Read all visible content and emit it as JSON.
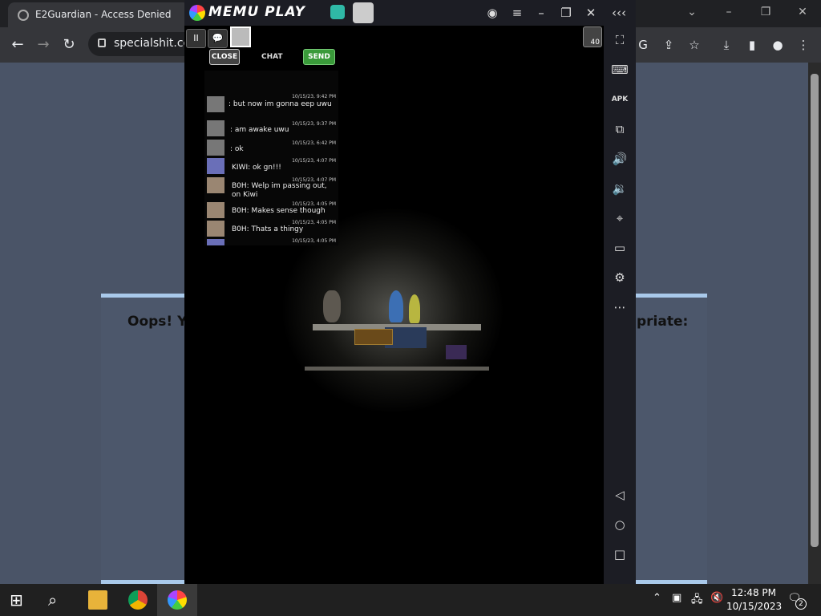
{
  "browser": {
    "tab_title": "E2Guardian - Access Denied",
    "url": "specialshit.com"
  },
  "page": {
    "message_left": "Oops! Yo",
    "message_right": "priate:"
  },
  "memu": {
    "logo": "MEMU PLAY",
    "chat": {
      "close_label": "CLOSE",
      "chat_label": "CHAT",
      "send_label": "SEND",
      "gem_count": "40",
      "messages": [
        {
          "time": "10/15/23, 9:42 PM",
          "text": ": but now im gonna eep uwu",
          "avatar": "gray"
        },
        {
          "time": "10/15/23, 9:37 PM",
          "text": ": am awake uwu",
          "avatar": "gray"
        },
        {
          "time": "10/15/23, 6:42 PM",
          "text": ": ok",
          "avatar": "gray"
        },
        {
          "time": "10/15/23, 4:07 PM",
          "text": "KIWI: ok gn!!!",
          "avatar": "kiwi"
        },
        {
          "time": "10/15/23, 4:07 PM",
          "text": "B0H: Welp im passing out, on Kiwi",
          "avatar": "boh"
        },
        {
          "time": "10/15/23, 4:05 PM",
          "text": "B0H: Makes sense though",
          "avatar": "boh"
        },
        {
          "time": "10/15/23, 4:05 PM",
          "text": "B0H: Thats a thingy",
          "avatar": "boh"
        },
        {
          "time": "10/15/23, 4:05 PM",
          "text": "",
          "avatar": "kiwi"
        }
      ]
    }
  },
  "taskbar": {
    "time": "12:48 PM",
    "date": "10/15/2023",
    "notification_count": "2"
  }
}
